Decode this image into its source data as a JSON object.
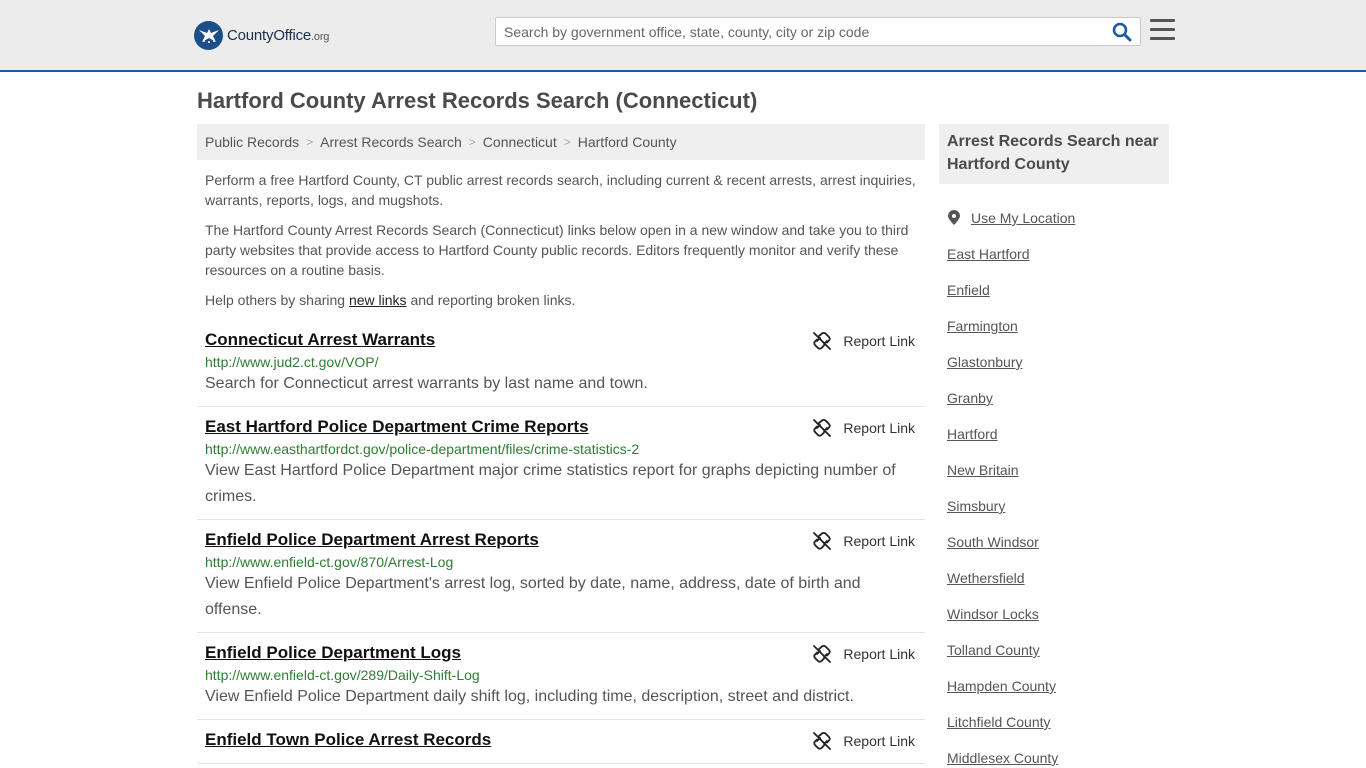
{
  "header": {
    "logo_text": "CountyOffice",
    "logo_suffix": ".org",
    "search_placeholder": "Search by government office, state, county, city or zip code"
  },
  "page_title": "Hartford County Arrest Records Search (Connecticut)",
  "breadcrumb": [
    "Public Records",
    "Arrest Records Search",
    "Connecticut",
    "Hartford County"
  ],
  "intro": {
    "p1": "Perform a free Hartford County, CT public arrest records search, including current & recent arrests, arrest inquiries, warrants, reports, logs, and mugshots.",
    "p2": "The Hartford County Arrest Records Search (Connecticut) links below open in a new window and take you to third party websites that provide access to Hartford County public records. Editors frequently monitor and verify these resources on a routine basis.",
    "p3_before": "Help others by sharing ",
    "p3_link": "new links",
    "p3_after": " and reporting broken links."
  },
  "report_label": "Report Link",
  "records": [
    {
      "title": "Connecticut Arrest Warrants",
      "url": "http://www.jud2.ct.gov/VOP/",
      "desc": "Search for Connecticut arrest warrants by last name and town."
    },
    {
      "title": "East Hartford Police Department Crime Reports",
      "url": "http://www.easthartfordct.gov/police-department/files/crime-statistics-2",
      "desc": "View East Hartford Police Department major crime statistics report for graphs depicting number of crimes."
    },
    {
      "title": "Enfield Police Department Arrest Reports",
      "url": "http://www.enfield-ct.gov/870/Arrest-Log",
      "desc": "View Enfield Police Department's arrest log, sorted by date, name, address, date of birth and offense."
    },
    {
      "title": "Enfield Police Department Logs",
      "url": "http://www.enfield-ct.gov/289/Daily-Shift-Log",
      "desc": "View Enfield Police Department daily shift log, including time, description, street and district."
    },
    {
      "title": "Enfield Town Police Arrest Records",
      "url": "",
      "desc": ""
    }
  ],
  "sidebar": {
    "heading": "Arrest Records Search near Hartford County",
    "use_location": "Use My Location",
    "links": [
      "East Hartford",
      "Enfield",
      "Farmington",
      "Glastonbury",
      "Granby",
      "Hartford",
      "New Britain",
      "Simsbury",
      "South Windsor",
      "Wethersfield",
      "Windsor Locks",
      "Tolland County",
      "Hampden County",
      "Litchfield County",
      "Middlesex County"
    ]
  },
  "colors": {
    "accent": "#1f5aa0",
    "url_green": "#2e7d32",
    "header_bg": "#ececec"
  }
}
